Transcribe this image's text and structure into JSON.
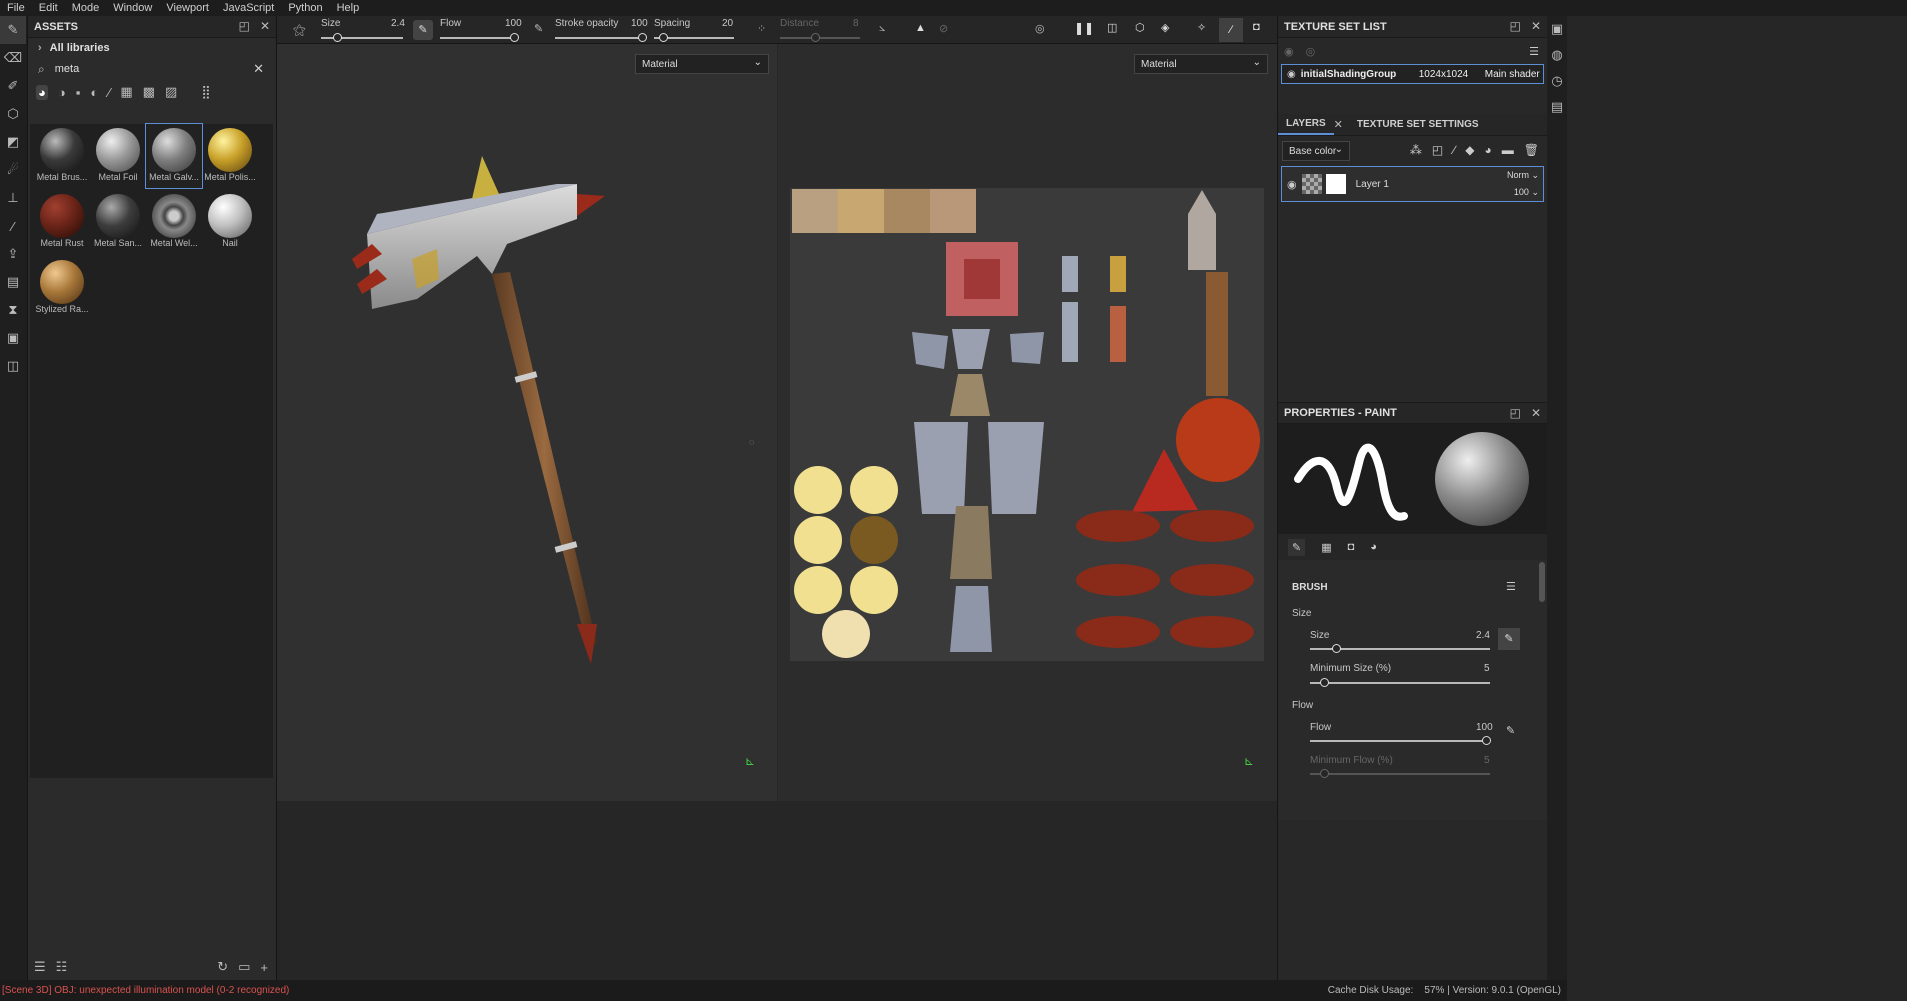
{
  "menu": [
    "File",
    "Edit",
    "Mode",
    "Window",
    "Viewport",
    "JavaScript",
    "Python",
    "Help"
  ],
  "assets": {
    "title": "ASSETS",
    "breadcrumb": "All libraries",
    "search_value": "meta",
    "materials": [
      {
        "label": "Metal Brus...",
        "color": "#3a3a3a"
      },
      {
        "label": "Metal Foil",
        "color": "#9a9a9a"
      },
      {
        "label": "Metal Galv...",
        "color": "#7f7f7f"
      },
      {
        "label": "Metal Polis...",
        "color": "#c8a028"
      },
      {
        "label": "Metal Rust",
        "color": "#6b2418"
      },
      {
        "label": "Metal San...",
        "color": "#3d3d3d"
      },
      {
        "label": "Metal Wel...",
        "color": "#555555"
      },
      {
        "label": "Nail",
        "color": "#bfbfbf"
      },
      {
        "label": "Stylized Ra...",
        "color": "#a8783a"
      }
    ]
  },
  "toolbar": {
    "size_label": "Size",
    "size_value": "2.4",
    "flow_label": "Flow",
    "flow_value": "100",
    "stroke_opacity_label": "Stroke opacity",
    "stroke_opacity_value": "100",
    "spacing_label": "Spacing",
    "spacing_value": "20",
    "distance_label": "Distance",
    "distance_value": "8"
  },
  "viewport": {
    "left_dropdown": "Material",
    "right_dropdown": "Material"
  },
  "texture_set_list": {
    "title": "TEXTURE SET LIST",
    "name": "initialShadingGroup",
    "resolution": "1024x1024",
    "shader": "Main shader"
  },
  "layers": {
    "tab_layers": "LAYERS",
    "tab_settings": "TEXTURE SET SETTINGS",
    "channel": "Base color",
    "layer_name": "Layer 1",
    "blend": "Norm",
    "opacity": "100"
  },
  "properties": {
    "title": "PROPERTIES - PAINT",
    "brush_section": "BRUSH",
    "size_group": "Size",
    "size_label": "Size",
    "size_value": "2.4",
    "minsize_label": "Minimum Size (%)",
    "minsize_value": "5",
    "flow_group": "Flow",
    "flow_label": "Flow",
    "flow_value": "100",
    "minflow_label": "Minimum Flow (%)",
    "minflow_value": "5"
  },
  "status": {
    "left": "[Scene 3D] OBJ: unexpected illumination model (0-2 recognized)",
    "right": "Cache Disk Usage:    57% | Version: 9.0.1 (OpenGL)"
  },
  "colors": {
    "accent": "#5d8fd6",
    "error": "#d9534f"
  }
}
